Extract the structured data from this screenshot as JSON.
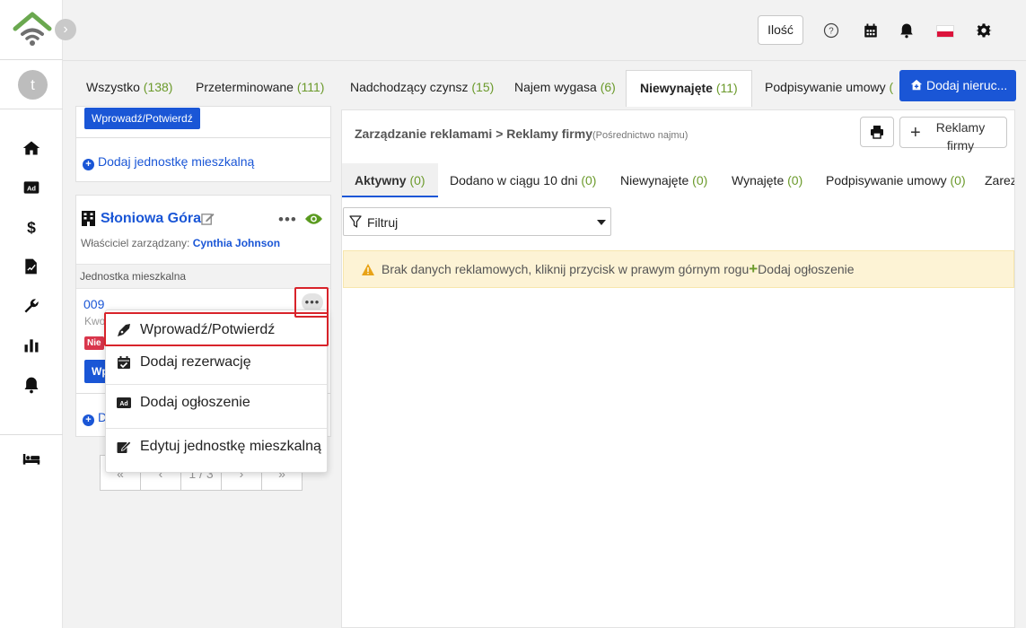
{
  "sidebar": {
    "avatar_initial": "t",
    "nav_icons": [
      "home-icon",
      "ad-icon",
      "dollar-icon",
      "contract-icon",
      "wrench-icon",
      "chart-icon",
      "bell-icon",
      "bed-icon"
    ]
  },
  "topbar": {
    "ilosc_label": "Ilość",
    "icons": [
      "help-icon",
      "calendar-icon",
      "notification-bell-icon",
      "poland-flag-icon",
      "settings-gear-icon"
    ]
  },
  "tabs": [
    {
      "label": "Wszystko",
      "count": "(138)"
    },
    {
      "label": "Przeterminowane",
      "count": "(111)"
    },
    {
      "label": "Nadchodzący czynsz",
      "count": "(15)"
    },
    {
      "label": "Najem wygasa",
      "count": "(6)"
    },
    {
      "label": "Niewynajęte",
      "count": "(11)"
    },
    {
      "label": "Podpisywanie umowy",
      "count": "("
    }
  ],
  "add_property_label": "Dodaj nieruc...",
  "cards": {
    "confirm_btn": "Wprowadź/Potwierdź",
    "add_unit_link": "Dodaj jednostkę mieszkalną",
    "property_name": "Słoniowa Góra",
    "owner_label": "Właściciel zarządzany:",
    "owner_name": "Cynthia Johnson",
    "unit_section": "Jednostka mieszkalna",
    "unit_number": "009",
    "unit_sub_partial": "Kwo",
    "unit_badge_partial": "Nie",
    "unit_btn_partial": "Wp",
    "add_partial": "D"
  },
  "menu": {
    "items": [
      {
        "label": "Wprowadź/Potwierdź",
        "icon": "pen-nib-icon"
      },
      {
        "label": "Dodaj rezerwację",
        "icon": "calendar-check-icon"
      },
      {
        "label": "Dodaj ogłoszenie",
        "icon": "ad-icon"
      },
      {
        "label": "Edytuj jednostkę mieszkalną",
        "icon": "edit-icon"
      }
    ]
  },
  "pagination": {
    "first": "«",
    "prev": "‹",
    "current": "1 / 3",
    "next": "›",
    "last": "»"
  },
  "main": {
    "breadcrumb_root": "Zarządzanie reklamami",
    "breadcrumb_sep": ">",
    "breadcrumb_leaf": "Reklamy firmy",
    "breadcrumb_sub": "(Pośrednictwo najmu)",
    "reklamy_btn": "Reklamy firmy",
    "subtabs": [
      {
        "label": "Aktywny",
        "count": "(0)"
      },
      {
        "label": "Dodano w ciągu 10 dni",
        "count": "(0)"
      },
      {
        "label": "Niewynajęte",
        "count": "(0)"
      },
      {
        "label": "Wynajęte",
        "count": "(0)"
      },
      {
        "label": "Podpisywanie umowy",
        "count": "(0)"
      },
      {
        "label": "Zarez",
        "count": ""
      }
    ],
    "filter_label": "Filtruj",
    "alert_text": "Brak danych reklamowych, kliknij przycisk w prawym górnym rogu",
    "alert_plus": "+",
    "alert_link": "Dodaj ogłoszenie"
  },
  "colors": {
    "primary": "#1a56d6",
    "count_green": "#6b9a2b",
    "alert_bg": "#fdf3d5",
    "highlight_red": "#d8232a",
    "eye_green": "#5a9a1f"
  }
}
